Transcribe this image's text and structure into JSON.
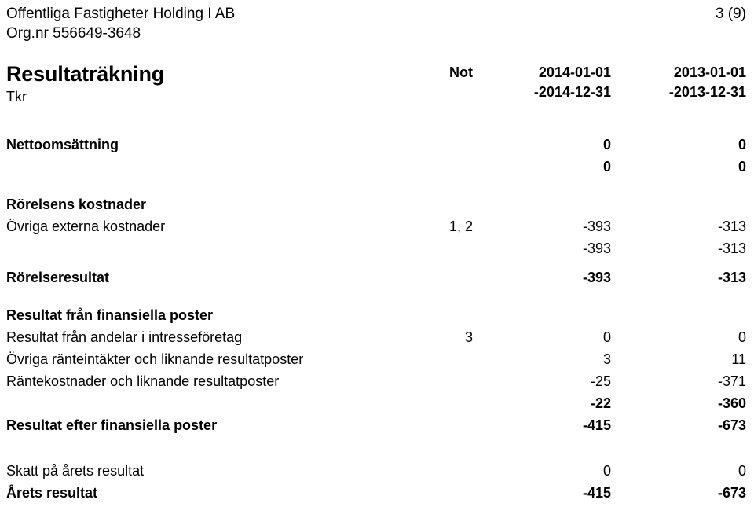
{
  "header": {
    "company": "Offentliga Fastigheter Holding I AB",
    "orgnr": "Org.nr 556649-3648",
    "page_number": "3 (9)"
  },
  "statement": {
    "title": "Resultaträkning",
    "unit": "Tkr",
    "columns": {
      "note_header": "Not",
      "period_current_line1": "2014-01-01",
      "period_current_line2": "-2014-12-31",
      "period_previous_line1": "2013-01-01",
      "period_previous_line2": "-2013-12-31"
    }
  },
  "rows": [
    {
      "label": "Nettoomsättning",
      "note": "",
      "current": "0",
      "previous": "0",
      "bold": true,
      "name": "row-nettoomsattning"
    },
    {
      "label": "",
      "note": "",
      "current": "0",
      "previous": "0",
      "bold": true,
      "name": "row-nettoomsattning-subtotal"
    },
    {
      "label": "Rörelsens kostnader",
      "note": "",
      "current": "",
      "previous": "",
      "bold": true,
      "name": "row-rorelsens-kostnader-heading"
    },
    {
      "label": "Övriga externa kostnader",
      "note": "1, 2",
      "current": "-393",
      "previous": "-313",
      "bold": false,
      "name": "row-ovriga-externa-kostnader"
    },
    {
      "label": "",
      "note": "",
      "current": "-393",
      "previous": "-313",
      "bold": false,
      "name": "row-kostnader-subtotal"
    },
    {
      "label": "Rörelseresultat",
      "note": "",
      "current": "-393",
      "previous": "-313",
      "bold": true,
      "name": "row-rorelseresultat"
    },
    {
      "label": "Resultat från finansiella poster",
      "note": "",
      "current": "",
      "previous": "",
      "bold": true,
      "name": "row-finansiella-poster-heading"
    },
    {
      "label": "Resultat från andelar i intresseföretag",
      "note": "3",
      "current": "0",
      "previous": "0",
      "bold": false,
      "name": "row-resultat-andelar-intressefortag"
    },
    {
      "label": "Övriga ränteintäkter och liknande resultatposter",
      "note": "",
      "current": "3",
      "previous": "11",
      "bold": false,
      "name": "row-ovriga-ranteintakter"
    },
    {
      "label": "Räntekostnader och liknande resultatposter",
      "note": "",
      "current": "-25",
      "previous": "-371",
      "bold": false,
      "name": "row-rantekostnader"
    },
    {
      "label": "",
      "note": "",
      "current": "-22",
      "previous": "-360",
      "bold": true,
      "name": "row-finansiella-subtotal"
    },
    {
      "label": "Resultat efter finansiella poster",
      "note": "",
      "current": "-415",
      "previous": "-673",
      "bold": true,
      "name": "row-resultat-efter-finansiella-poster"
    },
    {
      "label": "Skatt på årets resultat",
      "note": "",
      "current": "0",
      "previous": "0",
      "bold": false,
      "name": "row-skatt-pa-arets-resultat"
    },
    {
      "label": "Årets resultat",
      "note": "",
      "current": "-415",
      "previous": "-673",
      "bold": true,
      "name": "row-arets-resultat"
    }
  ],
  "row_spacing": [
    "none",
    "none",
    "gap-before",
    "none",
    "none",
    "gap-before-sm",
    "gap-before",
    "none",
    "none",
    "none",
    "none",
    "none",
    "gap-before-lg",
    "none"
  ]
}
